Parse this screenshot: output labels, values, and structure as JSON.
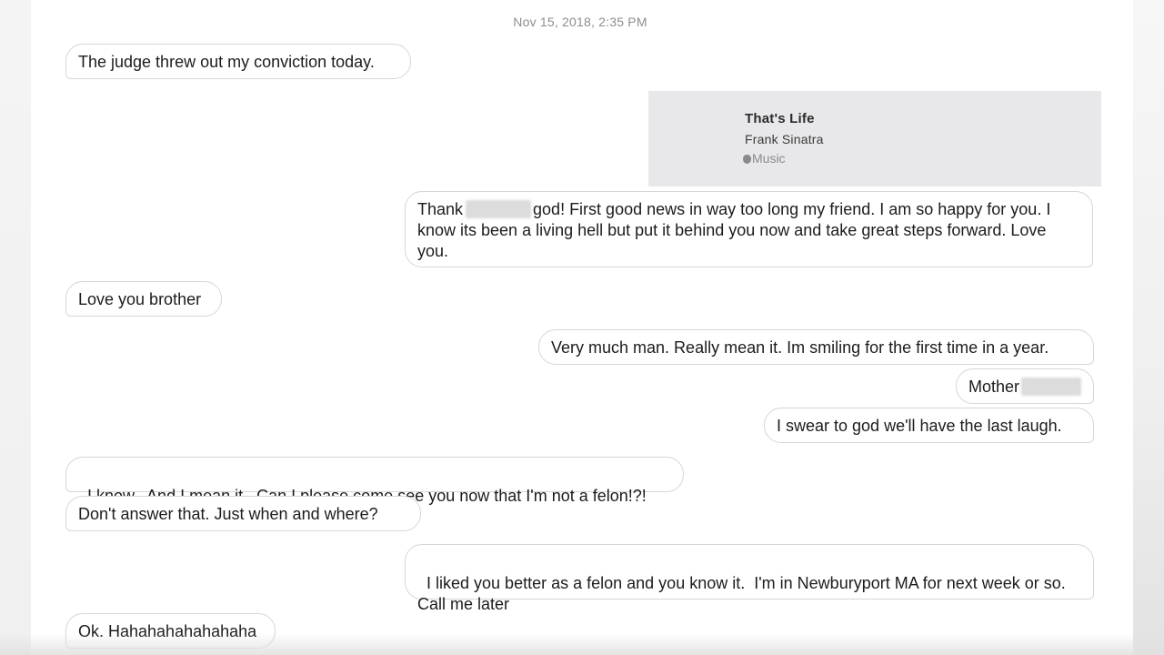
{
  "conversation": {
    "timestamp": "Nov 15, 2018, 2:35 PM",
    "music_card": {
      "title": "That's Life",
      "artist": "Frank Sinatra",
      "service": "Music",
      "service_icon": "apple-logo-icon"
    },
    "messages": [
      {
        "direction": "incoming",
        "text": "The judge threw out my conviction today."
      },
      {
        "direction": "outgoing",
        "part1": "Thank",
        "part2": "god! First good news in way too long my friend. I am so happy for you. I know its been a living hell but put it behind you now and take great steps forward. Love you."
      },
      {
        "direction": "incoming",
        "text": "Love you brother"
      },
      {
        "direction": "outgoing",
        "text": "Very much man. Really mean it. Im smiling for the first time in a year."
      },
      {
        "direction": "outgoing",
        "text": "Mother"
      },
      {
        "direction": "outgoing",
        "text": "I swear to god we'll have the last laugh."
      },
      {
        "direction": "incoming",
        "text": "I know.  And I mean it.  Can I please come see you now that I'm not a felon!?!"
      },
      {
        "direction": "incoming",
        "text": "Don't answer that. Just when and where?"
      },
      {
        "direction": "outgoing",
        "text": "I liked you better as a felon and you know it.  I'm in Newburyport MA for next week or so. Call me later"
      },
      {
        "direction": "incoming",
        "text": "Ok. Hahahahahahahaha"
      }
    ]
  }
}
